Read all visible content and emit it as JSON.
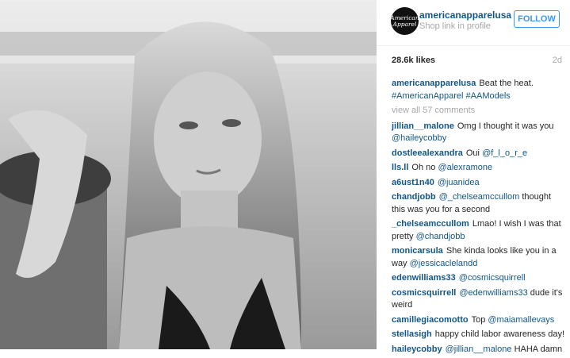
{
  "header": {
    "avatar_line1": "American",
    "avatar_line2": "Apparel",
    "username": "americanapparelusa",
    "location": "Shop link in profile",
    "follow_label": "FOLLOW"
  },
  "meta": {
    "likes": "28.6k likes",
    "age": "2d"
  },
  "caption": {
    "user": "americanapparelusa",
    "text": "Beat the heat.",
    "tags": "#AmericanApparel #AAModels"
  },
  "view_all": "view all 57 comments",
  "comments": [
    {
      "user": "jillian__malone",
      "text": "Omg I thought it was you",
      "mention": "@haileycobby"
    },
    {
      "user": "dostleealexandra",
      "text": "Oui",
      "mention": "@f_l_o_r_e"
    },
    {
      "user": "lls.ll",
      "text": "Oh no",
      "mention": "@alexramone"
    },
    {
      "user": "a6ust1n40",
      "text": "",
      "mention": "@juanidea"
    },
    {
      "user": "chandjobb",
      "text": "thought this was you for a second",
      "mention": "@_chelseamccullom"
    },
    {
      "user": "_chelseamccullom",
      "text": "Lmao! I wish I was that pretty",
      "mention": "@chandjobb"
    },
    {
      "user": "monicarsula",
      "text": "She kinda looks like you in a way",
      "mention": "@jessicaclelandd"
    },
    {
      "user": "edenwilliams33",
      "text": "",
      "mention": "@cosmicsquirrell"
    },
    {
      "user": "cosmicsquirrell",
      "text": "dude it's weird",
      "mention": "@edenwilliams33"
    },
    {
      "user": "camillegiacomotto",
      "text": "Top",
      "mention": "@maiamallevays"
    },
    {
      "user": "stellasigh",
      "text": "happy child labor awareness day!",
      "mention": ""
    },
    {
      "user": "haileycobby",
      "text": "HAHA damn",
      "mention": "@jillian__malone"
    }
  ]
}
